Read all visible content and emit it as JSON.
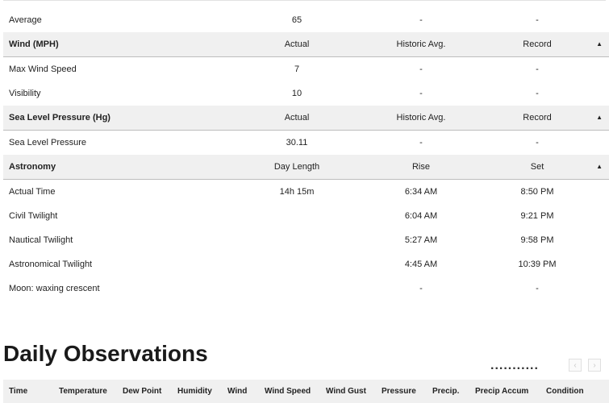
{
  "history": {
    "average_row": {
      "label": "Average",
      "actual": "65",
      "historic": "-",
      "record": "-"
    },
    "wind": {
      "header": {
        "title": "Wind (MPH)",
        "col1": "Actual",
        "col2": "Historic Avg.",
        "col3": "Record",
        "caret": "▲"
      },
      "rows": [
        {
          "label": "Max Wind Speed",
          "actual": "7",
          "historic": "-",
          "record": "-"
        },
        {
          "label": "Visibility",
          "actual": "10",
          "historic": "-",
          "record": "-"
        }
      ]
    },
    "pressure": {
      "header": {
        "title": "Sea Level Pressure (Hg)",
        "col1": "Actual",
        "col2": "Historic Avg.",
        "col3": "Record",
        "caret": "▲"
      },
      "rows": [
        {
          "label": "Sea Level Pressure",
          "actual": "30.11",
          "historic": "-",
          "record": "-"
        }
      ]
    },
    "astronomy": {
      "header": {
        "title": "Astronomy",
        "col1": "Day Length",
        "col2": "Rise",
        "col3": "Set",
        "caret": "▲"
      },
      "rows": [
        {
          "label": "Actual Time",
          "day_length": "14h 15m",
          "rise": "6:34 AM",
          "set": "8:50 PM"
        },
        {
          "label": "Civil Twilight",
          "day_length": "",
          "rise": "6:04 AM",
          "set": "9:21 PM"
        },
        {
          "label": "Nautical Twilight",
          "day_length": "",
          "rise": "5:27 AM",
          "set": "9:58 PM"
        },
        {
          "label": "Astronomical Twilight",
          "day_length": "",
          "rise": "4:45 AM",
          "set": "10:39 PM"
        },
        {
          "label": "Moon: waxing crescent",
          "day_length": "",
          "rise": "-",
          "set": "-"
        }
      ]
    }
  },
  "daily_observations": {
    "title": "Daily Observations",
    "dots": "...........",
    "prev_icon": "‹",
    "next_icon": "›",
    "columns": [
      "Time",
      "Temperature",
      "Dew Point",
      "Humidity",
      "Wind",
      "Wind Speed",
      "Wind Gust",
      "Pressure",
      "Precip.",
      "Precip Accum",
      "Condition"
    ]
  }
}
